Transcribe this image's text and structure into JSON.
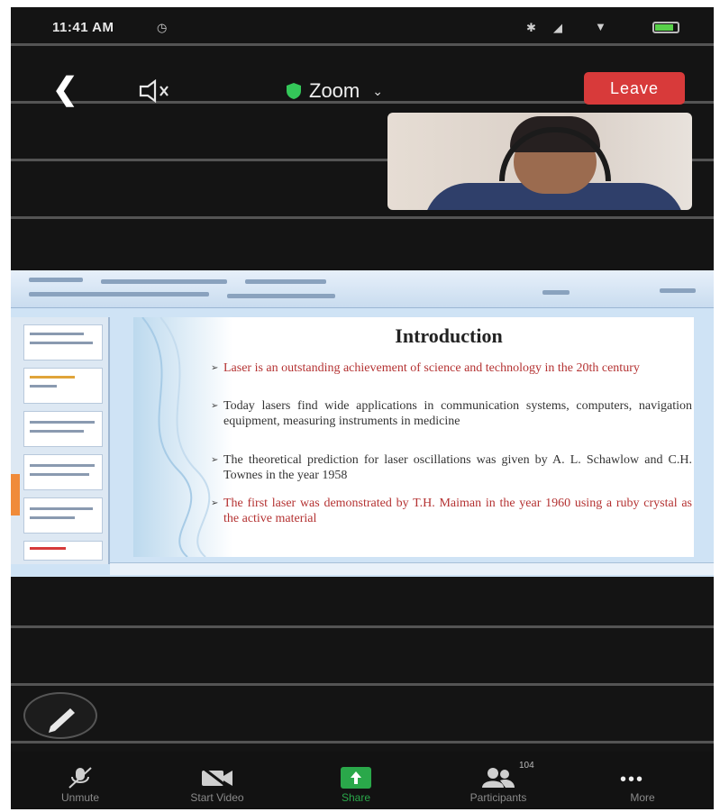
{
  "status_bar": {
    "time": "11:41 AM"
  },
  "top_bar": {
    "title": "Zoom",
    "leave_label": "Leave"
  },
  "slide": {
    "title": "Introduction",
    "bullets": [
      "Laser is an outstanding achievement of science and technology in the 20th century",
      "Today lasers find wide applications in communication systems, computers, navigation equipment, measuring instruments in medicine",
      "The theoretical prediction for laser oscillations was given by A. L. Schawlow and C.H. Townes in the year 1958",
      "The first laser was demonstrated by T.H. Maiman in the year 1960 using a ruby crystal as the active material"
    ]
  },
  "toolbar": {
    "unmute": "Unmute",
    "start_video": "Start Video",
    "share": "Share",
    "participants": "Participants",
    "participants_count": "104",
    "more": "More"
  },
  "colors": {
    "leave": "#d83a3a",
    "share_green": "#2aa84a",
    "shield_green": "#34c759"
  }
}
